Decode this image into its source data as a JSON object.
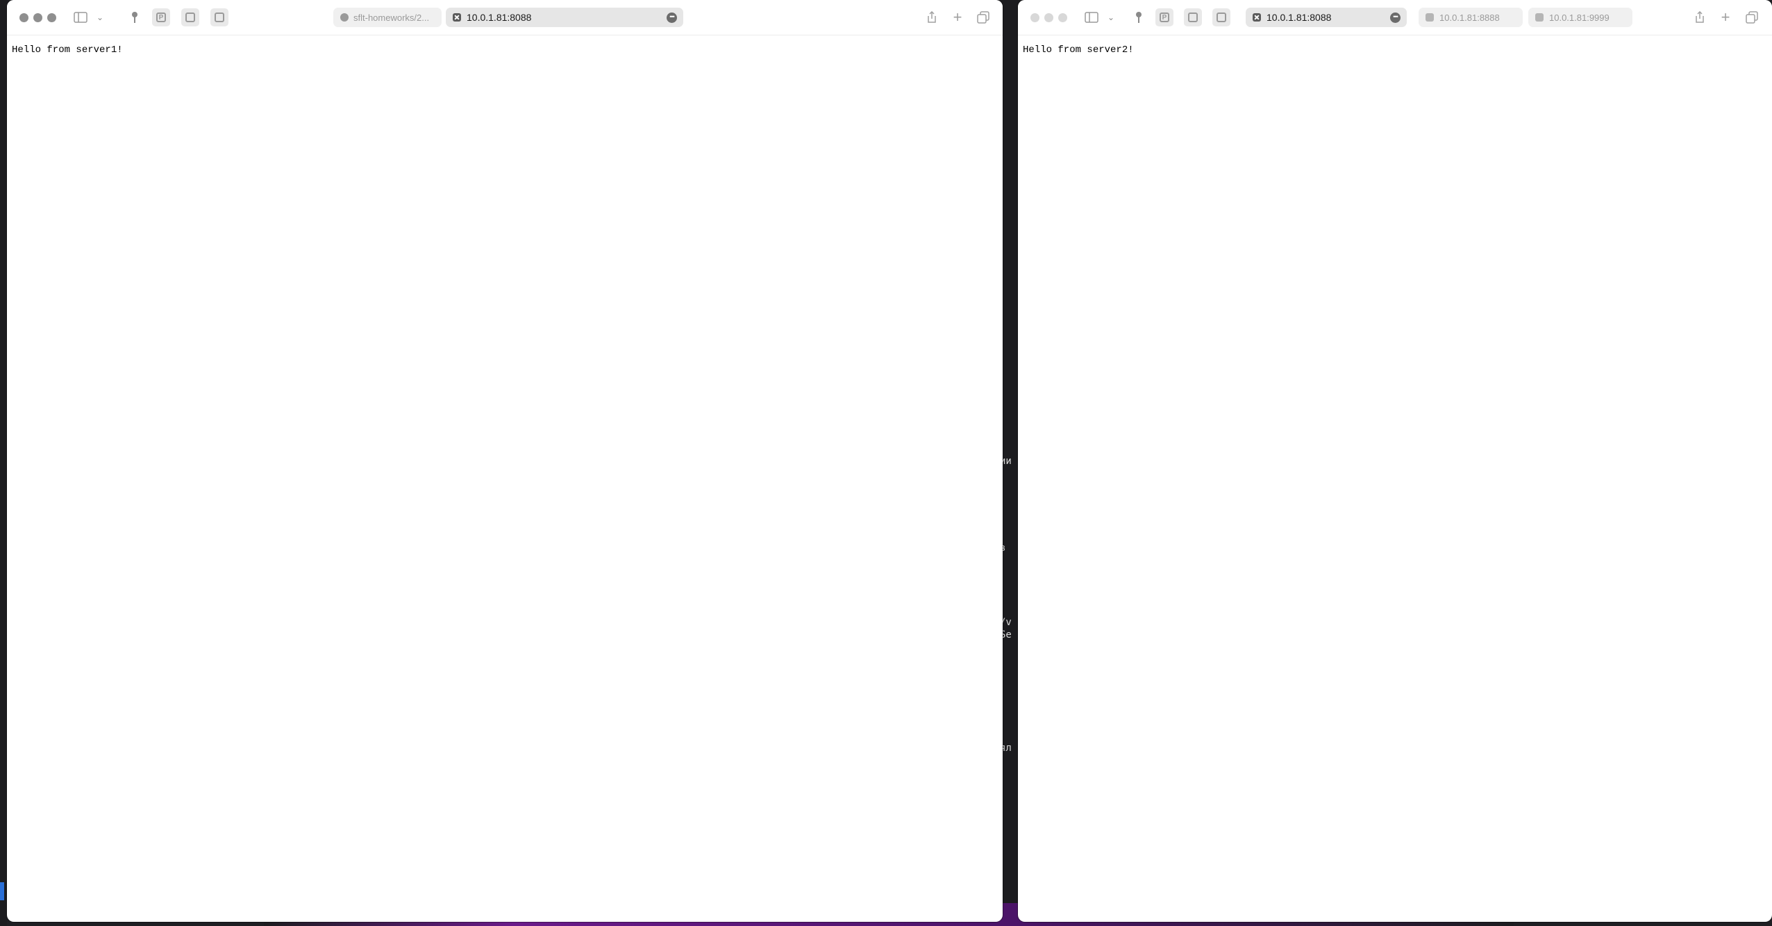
{
  "background_terminal": {
    "fragments": [
      "ии",
      "в",
      "/v",
      "Se",
      "ял"
    ]
  },
  "left_window": {
    "tabs": [
      {
        "label": "sflt-homeworks/2...",
        "icon": "github-icon",
        "active": false
      },
      {
        "label": "10.0.1.81:8088",
        "icon": "close-icon",
        "active": true
      }
    ],
    "page_text": "Hello from server1!"
  },
  "right_window": {
    "tabs": [
      {
        "label": "10.0.1.81:8088",
        "icon": "close-icon",
        "active": true
      },
      {
        "label": "10.0.1.81:8888",
        "icon": "page-icon",
        "active": false
      },
      {
        "label": "10.0.1.81:9999",
        "icon": "page-icon",
        "active": false
      }
    ],
    "page_text": "Hello from server2!"
  },
  "colors": {
    "traffic_light_inactive": "#8f8f8f",
    "accent_purple": "#6a1a8a",
    "desktop": "#1e1e22"
  }
}
